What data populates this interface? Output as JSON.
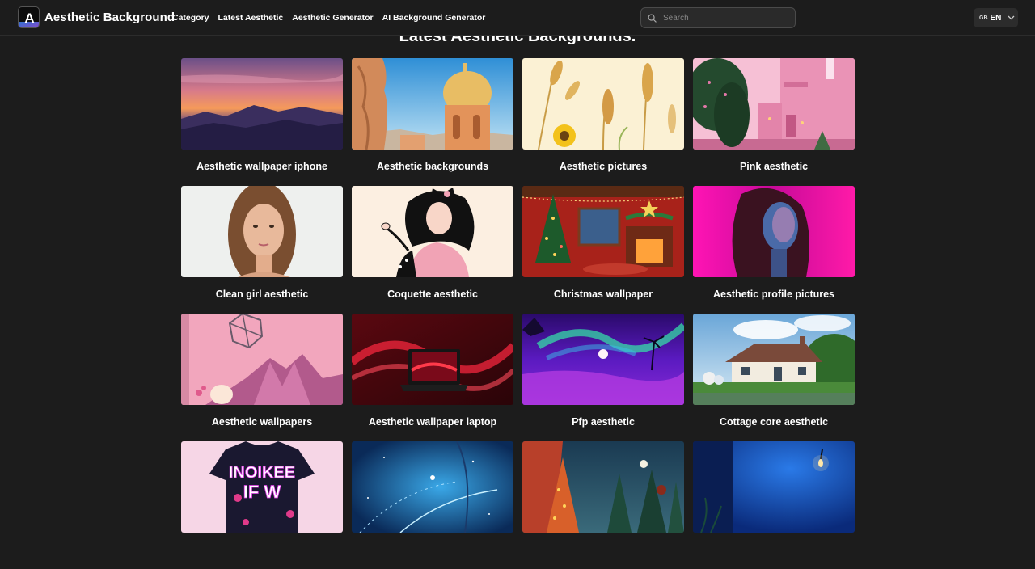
{
  "header": {
    "brand": "Aesthetic Background",
    "logo_letter": "A",
    "nav": [
      "Category",
      "Latest Aesthetic",
      "Aesthetic Generator",
      "AI Background Generator"
    ],
    "search_placeholder": "Search",
    "lang_flag": "GB",
    "lang_code": "EN"
  },
  "main": {
    "section_title": "Latest Aesthetic Backgrounds.",
    "cards": [
      {
        "label": "Aesthetic wallpaper iphone"
      },
      {
        "label": "Aesthetic backgrounds"
      },
      {
        "label": "Aesthetic pictures"
      },
      {
        "label": "Pink aesthetic"
      },
      {
        "label": "Clean girl aesthetic"
      },
      {
        "label": "Coquette aesthetic"
      },
      {
        "label": "Christmas wallpaper"
      },
      {
        "label": "Aesthetic profile pictures"
      },
      {
        "label": "Aesthetic wallpapers"
      },
      {
        "label": "Aesthetic wallpaper laptop"
      },
      {
        "label": "Pfp aesthetic"
      },
      {
        "label": "Cottage core aesthetic"
      },
      {
        "label": "",
        "shirt_text": "INOIKEE IF W"
      },
      {
        "label": ""
      },
      {
        "label": ""
      },
      {
        "label": ""
      }
    ]
  },
  "colors": {
    "background": "#1c1c1c",
    "text": "#ffffff",
    "border": "#2c2c2c"
  }
}
